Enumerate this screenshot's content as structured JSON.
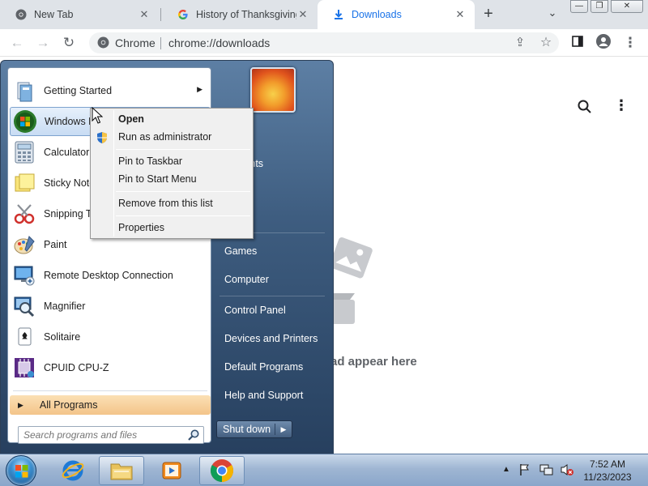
{
  "browser": {
    "tabs": [
      {
        "title": "New Tab"
      },
      {
        "title": "History of Thanksgiving"
      },
      {
        "title": "Downloads"
      }
    ],
    "toolbar": {
      "site_label": "Chrome",
      "url": "chrome://downloads"
    },
    "downloads_page": {
      "empty_message": "ad appear here"
    }
  },
  "start_menu": {
    "programs": [
      {
        "label": "Getting Started",
        "icon": "getting-started-icon",
        "has_submenu": true
      },
      {
        "label": "Windows M",
        "icon": "windows-media-center-icon",
        "has_submenu": false
      },
      {
        "label": "Calculator",
        "icon": "calculator-icon",
        "has_submenu": false
      },
      {
        "label": "Sticky Note",
        "icon": "sticky-notes-icon",
        "has_submenu": false
      },
      {
        "label": "Snipping To",
        "icon": "snipping-tool-icon",
        "has_submenu": false
      },
      {
        "label": "Paint",
        "icon": "paint-icon",
        "has_submenu": false
      },
      {
        "label": "Remote Desktop Connection",
        "icon": "remote-desktop-icon",
        "has_submenu": false
      },
      {
        "label": "Magnifier",
        "icon": "magnifier-icon",
        "has_submenu": false
      },
      {
        "label": "Solitaire",
        "icon": "solitaire-icon",
        "has_submenu": false
      },
      {
        "label": "CPUID CPU-Z",
        "icon": "cpu-z-icon",
        "has_submenu": false
      }
    ],
    "all_programs": "All Programs",
    "search_placeholder": "Search programs and files",
    "right_links": [
      {
        "label": "ments"
      },
      {
        "label": "s"
      },
      {
        "label": "Games"
      },
      {
        "label": "Computer"
      },
      {
        "label": "Control Panel"
      },
      {
        "label": "Devices and Printers"
      },
      {
        "label": "Default Programs"
      },
      {
        "label": "Help and Support"
      }
    ],
    "shutdown": "Shut down"
  },
  "context_menu": {
    "items": [
      {
        "label": "Open",
        "bold": true
      },
      {
        "label": "Run as administrator",
        "bold": false
      },
      {
        "label": "Pin to Taskbar",
        "bold": false
      },
      {
        "label": "Pin to Start Menu",
        "bold": false
      },
      {
        "label": "Remove from this list",
        "bold": false
      },
      {
        "label": "Properties",
        "bold": false
      }
    ]
  },
  "taskbar": {
    "pinned": [
      "internet-explorer-icon",
      "windows-explorer-icon",
      "media-player-icon",
      "chrome-icon"
    ],
    "clock_time": "7:52 AM",
    "clock_date": "11/23/2023"
  },
  "colors": {
    "chrome_tabstrip": "#dfe3e8",
    "start_menu_blue": "#3e5d80",
    "all_programs_highlight": "#f3c489",
    "taskbar": "#9fb6d3"
  }
}
